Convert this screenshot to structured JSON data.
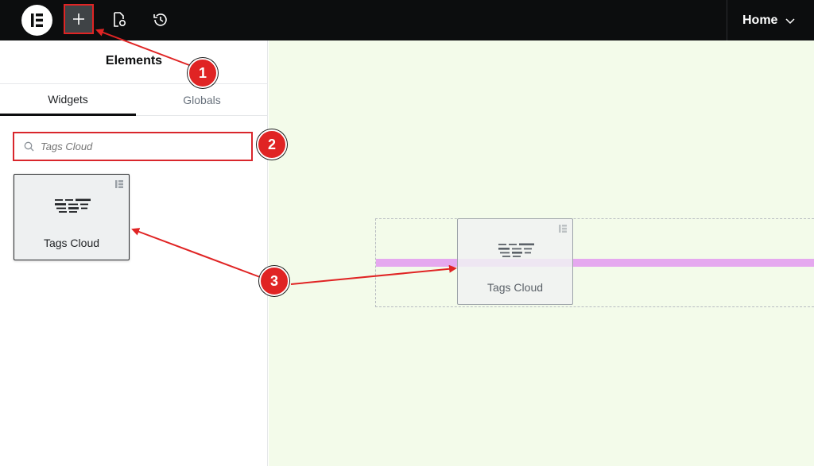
{
  "topbar": {
    "home_label": "Home"
  },
  "panel": {
    "title": "Elements",
    "tabs": [
      {
        "label": "Widgets",
        "active": true
      },
      {
        "label": "Globals",
        "active": false
      }
    ],
    "search": {
      "value": "",
      "placeholder": "Tags Cloud"
    },
    "widget": {
      "label": "Tags Cloud"
    }
  },
  "canvas": {
    "drag_widget_label": "Tags Cloud"
  },
  "annotations": {
    "steps": [
      "1",
      "2",
      "3"
    ]
  },
  "colors": {
    "topbar": "#0c0d0e",
    "highlight": "#e02424",
    "canvas_bg": "#f3fbea",
    "drop_line": "#e5a8ef"
  }
}
